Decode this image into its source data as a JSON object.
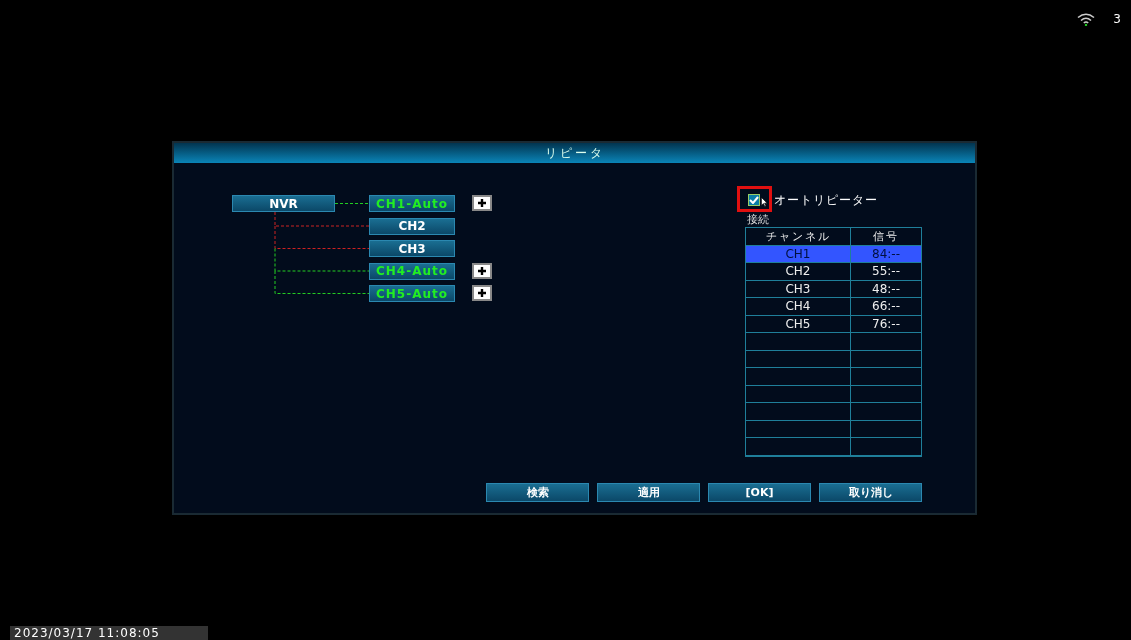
{
  "status": {
    "count": "3"
  },
  "dialog": {
    "title": "リピータ"
  },
  "tree": {
    "root": "NVR",
    "channels": [
      {
        "label": "CH1-Auto",
        "connected": true,
        "expandable": true
      },
      {
        "label": "CH2",
        "connected": false,
        "expandable": false
      },
      {
        "label": "CH3",
        "connected": false,
        "expandable": false
      },
      {
        "label": "CH4-Auto",
        "connected": true,
        "expandable": true
      },
      {
        "label": "CH5-Auto",
        "connected": true,
        "expandable": true
      }
    ]
  },
  "auto_repeater": {
    "label": "オートリピーター",
    "checked": true,
    "highlighted": true
  },
  "connection_label": "接続",
  "table": {
    "columns": [
      "チャンネル",
      "信号"
    ],
    "rows": [
      {
        "cells": [
          "CH1",
          "84:--"
        ],
        "selected": true
      },
      {
        "cells": [
          "CH2",
          "55:--"
        ],
        "selected": false
      },
      {
        "cells": [
          "CH3",
          "48:--"
        ],
        "selected": false
      },
      {
        "cells": [
          "CH4",
          "66:--"
        ],
        "selected": false
      },
      {
        "cells": [
          "CH5",
          "76:--"
        ],
        "selected": false
      }
    ]
  },
  "buttons": [
    "検索",
    "適用",
    "[OK]",
    "取り消し"
  ],
  "timestamp": "2023/03/17 11:08:05"
}
